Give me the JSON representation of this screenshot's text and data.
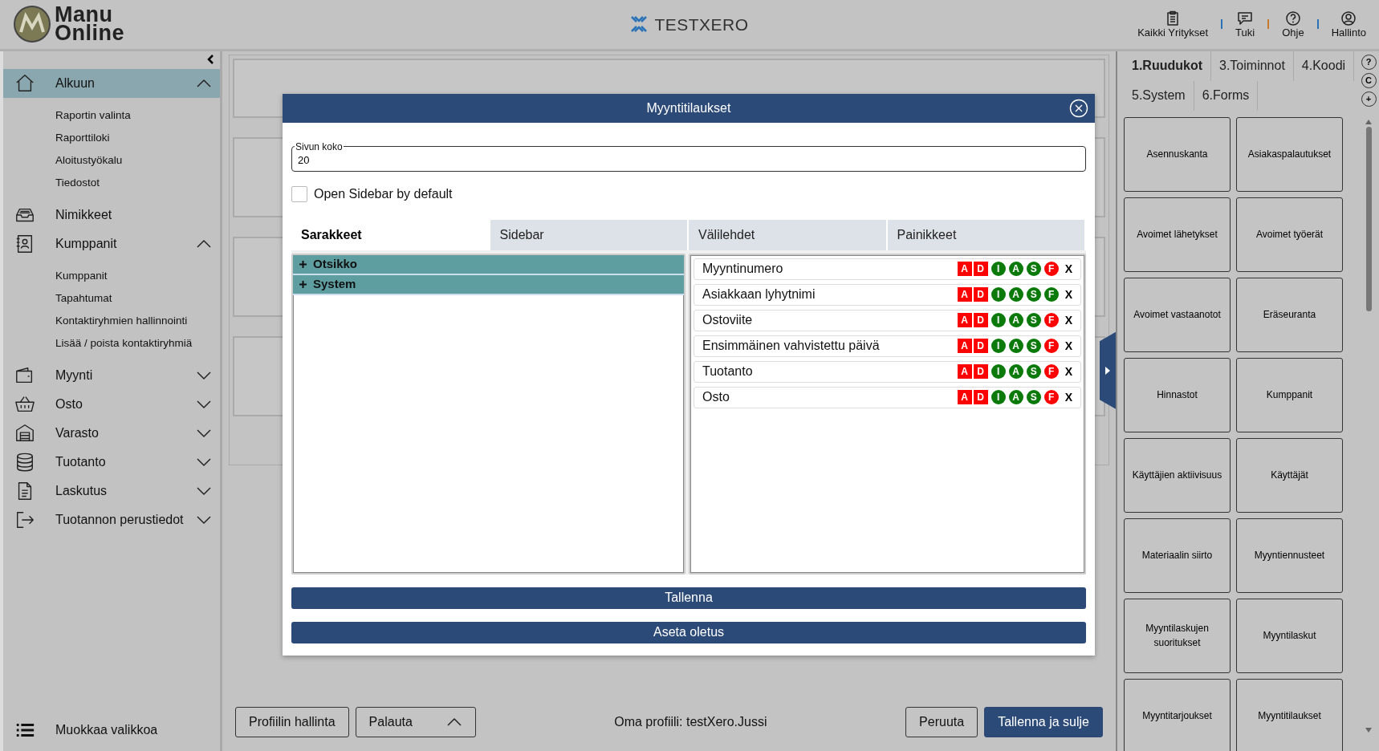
{
  "header": {
    "brand": "Manu Online",
    "title": "TESTXERO",
    "actions": [
      {
        "label": "Kaikki Yritykset"
      },
      {
        "label": "Tuki"
      },
      {
        "label": "Ohje"
      },
      {
        "label": "Hallinto"
      }
    ]
  },
  "sidebar": {
    "items": [
      {
        "label": "Alkuun",
        "selected": true,
        "expanded": true,
        "children": [
          {
            "label": "Raportin valinta"
          },
          {
            "label": "Raporttiloki"
          },
          {
            "label": "Aloitustyökalu"
          },
          {
            "label": "Tiedostot"
          }
        ]
      },
      {
        "label": "Nimikkeet",
        "selected": false
      },
      {
        "label": "Kumppanit",
        "selected": false,
        "expanded": true,
        "children": [
          {
            "label": "Kumppanit"
          },
          {
            "label": "Tapahtumat"
          },
          {
            "label": "Kontaktiryhmien hallinnointi"
          },
          {
            "label": "Lisää / poista kontaktiryhmiä"
          }
        ]
      },
      {
        "label": "Myynti",
        "selected": false,
        "expanded": false
      },
      {
        "label": "Osto",
        "selected": false,
        "expanded": false
      },
      {
        "label": "Varasto",
        "selected": false,
        "expanded": false
      },
      {
        "label": "Tuotanto",
        "selected": false,
        "expanded": false
      },
      {
        "label": "Laskutus",
        "selected": false,
        "expanded": false
      },
      {
        "label": "Tuotannon perustiedot",
        "selected": false,
        "expanded": false
      }
    ],
    "footer": "Muokkaa valikkoa"
  },
  "dialog": {
    "title": "Myyntitilaukset",
    "page_size": {
      "label": "Sivun koko",
      "value": "20"
    },
    "open_sidebar": {
      "label": "Open Sidebar by default",
      "checked": false
    },
    "left_pane": {
      "tabs": [
        {
          "label": "Sarakkeet",
          "selected": true
        },
        {
          "label": "Sidebar",
          "selected": false
        }
      ],
      "groups": [
        {
          "label": "Otsikko",
          "expanded": false
        },
        {
          "label": "System",
          "expanded": false
        }
      ]
    },
    "right_pane": {
      "tabs": [
        {
          "label": "Välilehdet",
          "selected": false
        },
        {
          "label": "Painikkeet",
          "selected": false
        }
      ],
      "fields": [
        {
          "name": "Myyntinumero",
          "badges": [
            {
              "text": "A",
              "kind": "square",
              "color": "#ff0000"
            },
            {
              "text": "D",
              "kind": "square",
              "color": "#ff0000"
            },
            {
              "text": "I",
              "kind": "circle",
              "color": "#0b7a0b"
            },
            {
              "text": "A",
              "kind": "circle",
              "color": "#0b7a0b"
            },
            {
              "text": "S",
              "kind": "circle",
              "color": "#0b7a0b"
            },
            {
              "text": "F",
              "kind": "circle",
              "color": "#ff0000"
            }
          ],
          "remove": "X"
        },
        {
          "name": "Asiakkaan lyhytnimi",
          "badges": [
            {
              "text": "A",
              "kind": "square",
              "color": "#ff0000"
            },
            {
              "text": "D",
              "kind": "square",
              "color": "#ff0000"
            },
            {
              "text": "I",
              "kind": "circle",
              "color": "#0b7a0b"
            },
            {
              "text": "A",
              "kind": "circle",
              "color": "#0b7a0b"
            },
            {
              "text": "S",
              "kind": "circle",
              "color": "#0b7a0b"
            },
            {
              "text": "F",
              "kind": "circle",
              "color": "#0b7a0b"
            }
          ],
          "remove": "X"
        },
        {
          "name": "Ostoviite",
          "badges": [
            {
              "text": "A",
              "kind": "square",
              "color": "#ff0000"
            },
            {
              "text": "D",
              "kind": "square",
              "color": "#ff0000"
            },
            {
              "text": "I",
              "kind": "circle",
              "color": "#0b7a0b"
            },
            {
              "text": "A",
              "kind": "circle",
              "color": "#0b7a0b"
            },
            {
              "text": "S",
              "kind": "circle",
              "color": "#0b7a0b"
            },
            {
              "text": "F",
              "kind": "circle",
              "color": "#ff0000"
            }
          ],
          "remove": "X"
        },
        {
          "name": "Ensimmäinen vahvistettu päivä",
          "badges": [
            {
              "text": "A",
              "kind": "square",
              "color": "#ff0000"
            },
            {
              "text": "D",
              "kind": "square",
              "color": "#ff0000"
            },
            {
              "text": "I",
              "kind": "circle",
              "color": "#0b7a0b"
            },
            {
              "text": "A",
              "kind": "circle",
              "color": "#0b7a0b"
            },
            {
              "text": "S",
              "kind": "circle",
              "color": "#0b7a0b"
            },
            {
              "text": "F",
              "kind": "circle",
              "color": "#ff0000"
            }
          ],
          "remove": "X"
        },
        {
          "name": "Tuotanto",
          "badges": [
            {
              "text": "A",
              "kind": "square",
              "color": "#ff0000"
            },
            {
              "text": "D",
              "kind": "square",
              "color": "#ff0000"
            },
            {
              "text": "I",
              "kind": "circle",
              "color": "#0b7a0b"
            },
            {
              "text": "A",
              "kind": "circle",
              "color": "#0b7a0b"
            },
            {
              "text": "S",
              "kind": "circle",
              "color": "#0b7a0b"
            },
            {
              "text": "F",
              "kind": "circle",
              "color": "#ff0000"
            }
          ],
          "remove": "X"
        },
        {
          "name": "Osto",
          "badges": [
            {
              "text": "A",
              "kind": "square",
              "color": "#ff0000"
            },
            {
              "text": "D",
              "kind": "square",
              "color": "#ff0000"
            },
            {
              "text": "I",
              "kind": "circle",
              "color": "#0b7a0b"
            },
            {
              "text": "A",
              "kind": "circle",
              "color": "#0b7a0b"
            },
            {
              "text": "S",
              "kind": "circle",
              "color": "#0b7a0b"
            },
            {
              "text": "F",
              "kind": "circle",
              "color": "#ff0000"
            }
          ],
          "remove": "X"
        }
      ]
    },
    "buttons": [
      "Tallenna",
      "Aseta oletus"
    ]
  },
  "footer_bar": {
    "profile_button": "Profiilin hallinta",
    "restore_dropdown": "Palauta",
    "profile_text": "Oma profiili: testXero.Jussi",
    "cancel_button": "Peruuta",
    "save_close_button": "Tallenna ja sulje"
  },
  "right_panel": {
    "tabs": [
      {
        "label": "1.Ruudukot",
        "selected": true
      },
      {
        "label": "3.Toiminnot",
        "selected": false
      },
      {
        "label": "4.Koodi",
        "selected": false
      },
      {
        "label": "5.System",
        "selected": false
      },
      {
        "label": "6.Forms",
        "selected": false
      }
    ],
    "tool_buttons": [
      "?",
      "C",
      "+"
    ],
    "tiles": [
      "Asennuskanta",
      "Asiakaspalautukset",
      "Avoimet lähetykset",
      "Avoimet työerät",
      "Avoimet vastaanotot",
      "Eräseuranta",
      "Hinnastot",
      "Kumppanit",
      "Käyttäjien aktiivisuus",
      "Käyttäjät",
      "Materiaalin siirto",
      "Myyntiennusteet",
      "Myyntilaskujen suoritukset",
      "Myyntilaskut",
      "Myyntitarjoukset",
      "Myyntitilaukset"
    ]
  }
}
